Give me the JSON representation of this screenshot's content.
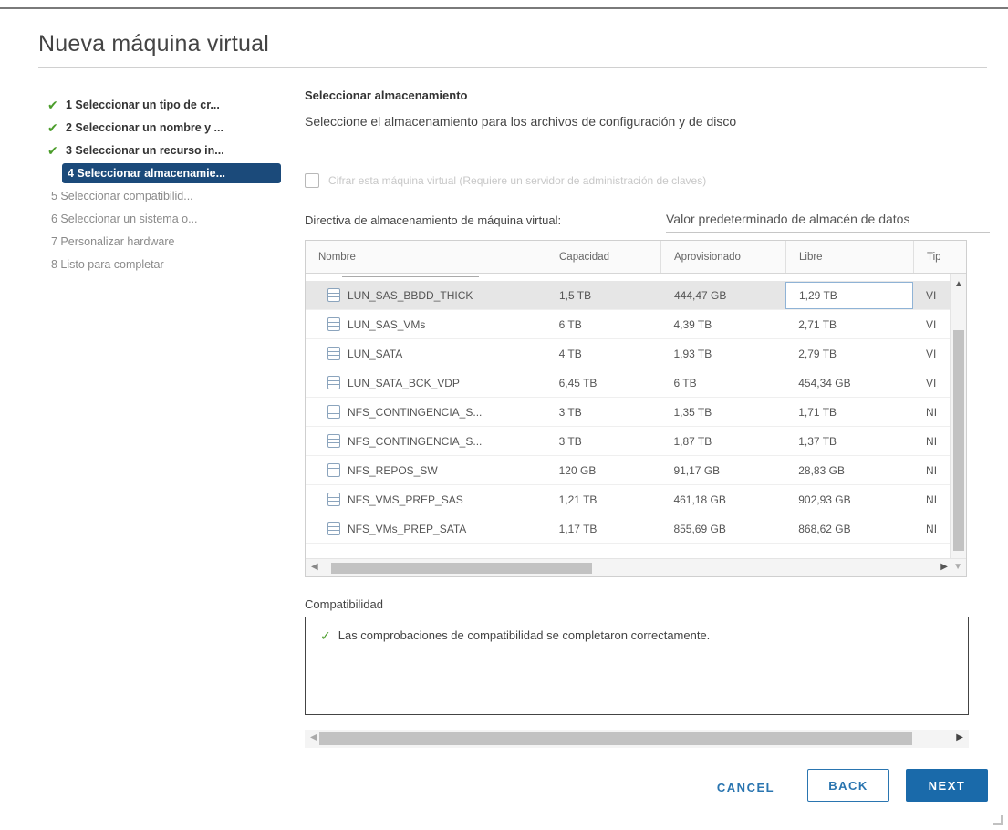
{
  "wizard": {
    "title": "Nueva máquina virtual"
  },
  "steps": [
    {
      "label": "1 Seleccionar un tipo de cr...",
      "state": "done"
    },
    {
      "label": "2 Seleccionar un nombre y ...",
      "state": "done"
    },
    {
      "label": "3 Seleccionar un recurso in...",
      "state": "done"
    },
    {
      "label": "4 Seleccionar almacenamie...",
      "state": "active"
    },
    {
      "label": "5 Seleccionar compatibilid...",
      "state": "pending"
    },
    {
      "label": "6 Seleccionar un sistema o...",
      "state": "pending"
    },
    {
      "label": "7 Personalizar hardware",
      "state": "pending"
    },
    {
      "label": "8 Listo para completar",
      "state": "pending"
    }
  ],
  "section": {
    "title": "Seleccionar almacenamiento",
    "description": "Seleccione el almacenamiento para los archivos de configuración y de disco",
    "encrypt_label": "Cifrar esta máquina virtual (Requiere un servidor de administración de claves)",
    "policy_label": "Directiva de almacenamiento de máquina virtual:",
    "policy_value": "Valor predeterminado de almacén de datos"
  },
  "table": {
    "columns": [
      "Nombre",
      "Capacidad",
      "Aprovisionado",
      "Libre",
      "Tip"
    ],
    "rows": [
      {
        "name": "LUN_SAS_BBDD_THICK",
        "capacity": "1,5 TB",
        "provisioned": "444,47 GB",
        "free": "1,29 TB",
        "type": "VI",
        "selected": true
      },
      {
        "name": "LUN_SAS_VMs",
        "capacity": "6 TB",
        "provisioned": "4,39 TB",
        "free": "2,71 TB",
        "type": "VI"
      },
      {
        "name": "LUN_SATA",
        "capacity": "4 TB",
        "provisioned": "1,93 TB",
        "free": "2,79 TB",
        "type": "VI"
      },
      {
        "name": "LUN_SATA_BCK_VDP",
        "capacity": "6,45 TB",
        "provisioned": "6 TB",
        "free": "454,34 GB",
        "type": "VI"
      },
      {
        "name": "NFS_CONTINGENCIA_S...",
        "capacity": "3 TB",
        "provisioned": "1,35 TB",
        "free": "1,71 TB",
        "type": "NI"
      },
      {
        "name": "NFS_CONTINGENCIA_S...",
        "capacity": "3 TB",
        "provisioned": "1,87 TB",
        "free": "1,37 TB",
        "type": "NI"
      },
      {
        "name": "NFS_REPOS_SW",
        "capacity": "120 GB",
        "provisioned": "91,17 GB",
        "free": "28,83 GB",
        "type": "NI"
      },
      {
        "name": "NFS_VMS_PREP_SAS",
        "capacity": "1,21 TB",
        "provisioned": "461,18 GB",
        "free": "902,93 GB",
        "type": "NI"
      },
      {
        "name": "NFS_VMs_PREP_SATA",
        "capacity": "1,17 TB",
        "provisioned": "855,69 GB",
        "free": "868,62 GB",
        "type": "NI"
      }
    ]
  },
  "compatibility": {
    "label": "Compatibilidad",
    "message": "Las comprobaciones de compatibilidad se completaron correctamente."
  },
  "buttons": {
    "cancel": "CANCEL",
    "back": "BACK",
    "next": "NEXT"
  },
  "colors": {
    "active_step": "#1b4a7a",
    "success": "#4b9d2b",
    "primary": "#1a6aaa"
  }
}
